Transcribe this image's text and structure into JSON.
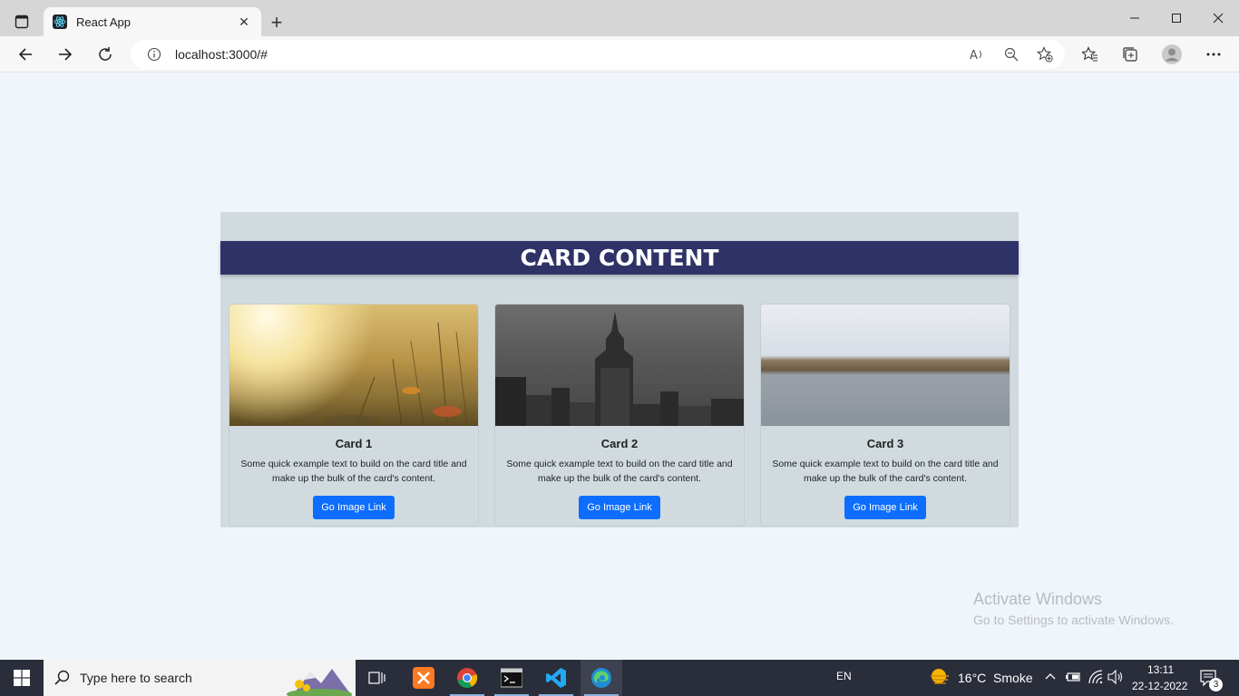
{
  "browser": {
    "tab_title": "React App",
    "url": "localhost:3000/#",
    "icons": [
      "tab-actions-icon",
      "react-favicon-icon",
      "close-tab-icon",
      "new-tab-icon",
      "minimize-icon",
      "maximize-icon",
      "close-window-icon",
      "back-icon",
      "forward-icon",
      "refresh-icon",
      "info-icon",
      "read-aloud-icon",
      "zoom-out-icon",
      "add-favorite-icon",
      "favorites-icon",
      "collections-icon",
      "profile-avatar-icon",
      "more-menu-icon"
    ]
  },
  "page": {
    "header": "CARD CONTENT",
    "cards": [
      {
        "title": "Card 1",
        "text": "Some quick example text to build on the card title and make up the bulk of the card's content.",
        "button": "Go Image Link"
      },
      {
        "title": "Card 2",
        "text": "Some quick example text to build on the card title and make up the bulk of the card's content.",
        "button": "Go Image Link"
      },
      {
        "title": "Card 3",
        "text": "Some quick example text to build on the card title and make up the bulk of the card's content.",
        "button": "Go Image Link"
      }
    ],
    "colors": {
      "header_bg": "#2e3266",
      "panel_bg": "#d1dbdf",
      "button_bg": "#0d6efd",
      "page_bg": "#f0f5fc"
    }
  },
  "watermark": {
    "line1": "Activate Windows",
    "line2": "Go to Settings to activate Windows."
  },
  "taskbar": {
    "search_placeholder": "Type here to search",
    "language": "EN",
    "weather": "16°C  Smoke",
    "time": "13:11",
    "date": "22-12-2022",
    "notification_count": "3"
  }
}
